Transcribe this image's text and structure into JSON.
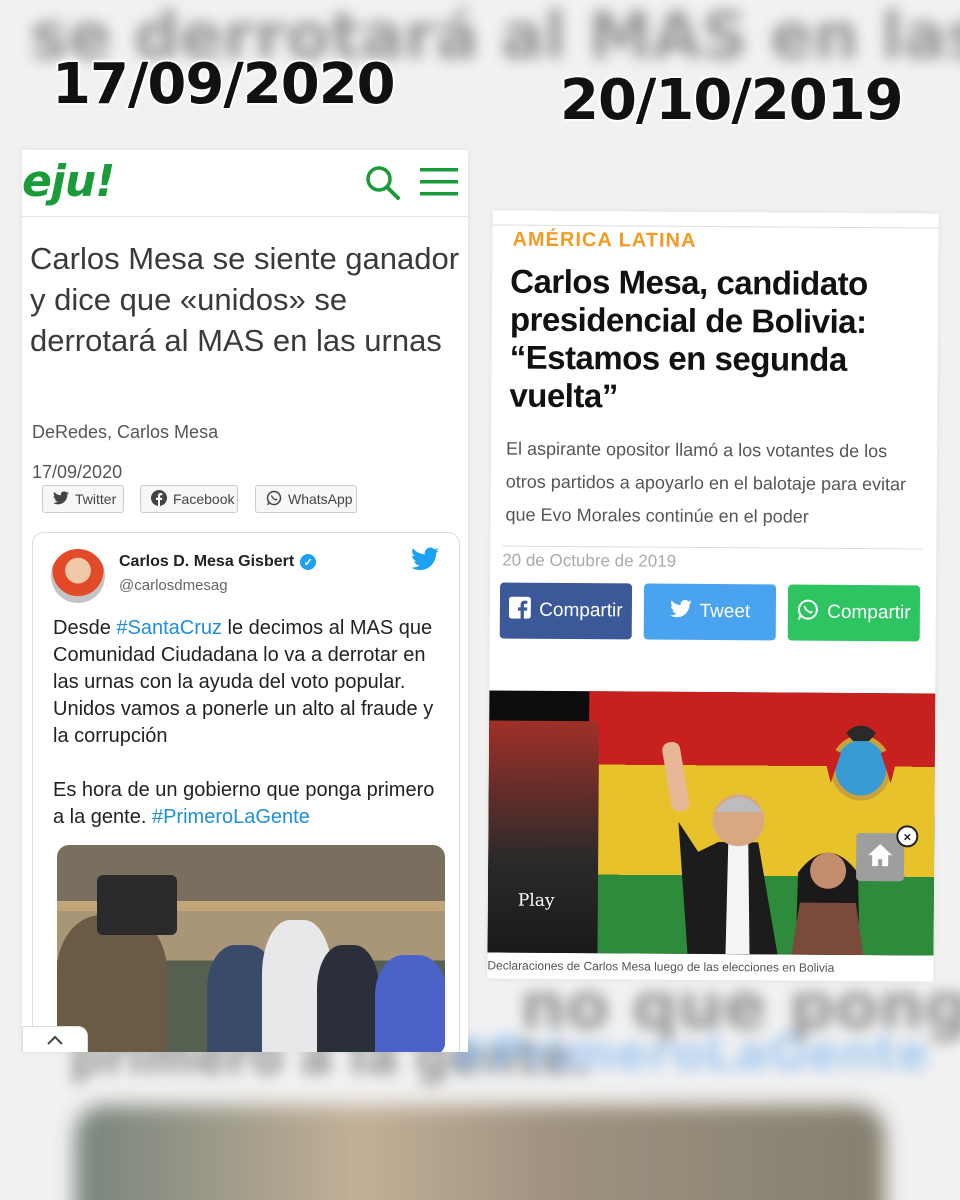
{
  "overlay": {
    "date_left": "17/09/2020",
    "date_right": "20/10/2019",
    "blurred_bg_top": "se derrotará al MAS en las urnas",
    "blurred_bg_bottom_1": "no que ponga",
    "blurred_bg_bottom_2": "primero a la gente.",
    "blurred_bg_bottom_3": "#PrimeroLaGente"
  },
  "left_article": {
    "logo": "eju!",
    "brand_color": "#1a9b3a",
    "title": "Carlos Mesa se siente ganador y dice que «unidos» se derrotará al MAS en las urnas",
    "byline": "DeRedes, Carlos Mesa",
    "date": "17/09/2020",
    "share": {
      "twitter": "Twitter",
      "facebook": "Facebook",
      "whatsapp": "WhatsApp"
    },
    "tweet": {
      "name": "Carlos D. Mesa Gisbert",
      "handle": "@carlosdmesag",
      "text_1": "Desde ",
      "tag_1": "#SantaCruz",
      "text_2": " le decimos al MAS que Comunidad Ciudadana lo va a derrotar en las urnas con la ayuda del voto popular. Unidos vamos a ponerle un alto al fraude y la corrupción",
      "text_3": "Es hora de un gobierno que ponga primero a la gente. ",
      "tag_2": "#PrimeroLaGente"
    }
  },
  "right_article": {
    "category": "AMÉRICA LATINA",
    "category_color": "#f39a24",
    "title": "Carlos Mesa, candidato presidencial de Bolivia: “Estamos en segunda vuelta”",
    "subtitle": "El aspirante opositor llamó a los votantes de los otros partidos a apoyarlo en el balotaje para evitar que Evo Morales continúe en el poder",
    "date": "20 de Octubre de 2019",
    "buttons": {
      "facebook": "Compartir",
      "twitter": "Tweet",
      "whatsapp": "Compartir"
    },
    "colors": {
      "facebook": "#3b5998",
      "twitter": "#4aa3ef",
      "whatsapp": "#2ec462"
    },
    "video_play": "Play",
    "caption": "Declaraciones de Carlos Mesa luego de las elecciones en Bolivia"
  }
}
